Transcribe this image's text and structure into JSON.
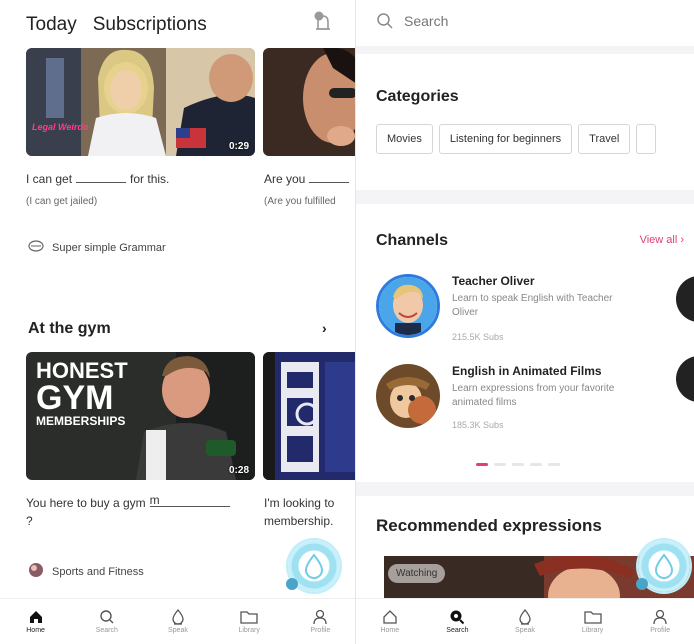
{
  "left": {
    "tabs": [
      "Today",
      "Subscriptions"
    ],
    "clip1": {
      "duration": "0:29",
      "badge_text": "Legal Weirdo",
      "sentence_before": "I can get",
      "sentence_after": "for this.",
      "translation": "(I can get jailed)",
      "source": "Super simple Grammar"
    },
    "clip2": {
      "sentence": "Are you",
      "translation": "(Are you fulfilled"
    },
    "section": {
      "title": "At the gym",
      "chevron": "›"
    },
    "clip3": {
      "duration": "0:28",
      "overlay_line1": "HONEST",
      "overlay_line2": "GYM",
      "overlay_line3": "MEMBERSHIPS",
      "sentence": "You here to buy a gym",
      "blank_hint": "m",
      "sentence_line2": "?",
      "source": "Sports and Fitness"
    },
    "clip4": {
      "sentence_line1": "I'm looking to",
      "sentence_line2": "membership."
    },
    "nav": [
      {
        "label": "Home",
        "icon": "home-icon",
        "active": true
      },
      {
        "label": "Search",
        "icon": "search-icon",
        "active": false
      },
      {
        "label": "Speak",
        "icon": "mic-icon",
        "active": false
      },
      {
        "label": "Library",
        "icon": "folder-icon",
        "active": false
      },
      {
        "label": "Profile",
        "icon": "profile-icon",
        "active": false
      }
    ]
  },
  "right": {
    "search": {
      "placeholder": "Search"
    },
    "categories": {
      "title": "Categories",
      "chips": [
        "Movies",
        "Listening for beginners",
        "Travel"
      ]
    },
    "channels": {
      "title": "Channels",
      "view_all": "View all ›",
      "items": [
        {
          "name": "Teacher Oliver",
          "desc_line1": "Learn to speak English with Teacher",
          "desc_line2": "Oliver",
          "subs": "215.5K Subs"
        },
        {
          "name": "English in Animated Films",
          "desc_line1": "Learn expressions from your favorite",
          "desc_line2": "animated films",
          "subs": "185.3K Subs"
        }
      ]
    },
    "recommended": {
      "title": "Recommended expressions",
      "badge": "Watching"
    },
    "nav": [
      {
        "label": "Home",
        "icon": "home-icon",
        "active": false
      },
      {
        "label": "Search",
        "icon": "search-icon",
        "active": true
      },
      {
        "label": "Speak",
        "icon": "mic-icon",
        "active": false
      },
      {
        "label": "Library",
        "icon": "folder-icon",
        "active": false
      },
      {
        "label": "Profile",
        "icon": "profile-icon",
        "active": false
      }
    ]
  },
  "colors": {
    "accent": "#e23c7c",
    "fab": "#9ee2f2"
  }
}
